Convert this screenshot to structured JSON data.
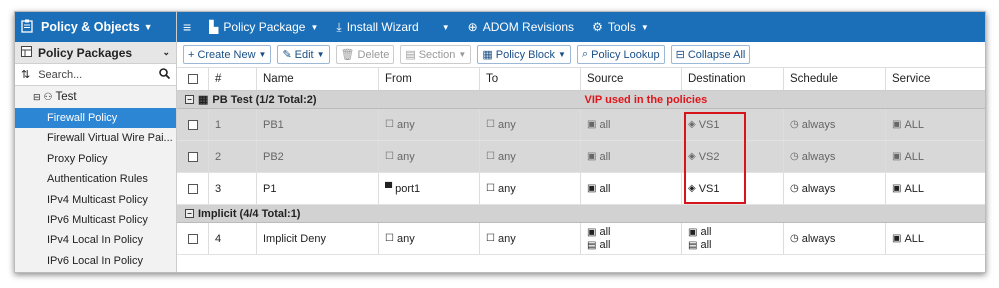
{
  "left_panel": {
    "header_title": "Policy & Objects",
    "section_title": "Policy Packages",
    "search_placeholder": "Search...",
    "tree_root": "Test",
    "nav_items": [
      {
        "label": "Firewall Policy",
        "active": true
      },
      {
        "label": "Firewall Virtual Wire Pai...",
        "active": false
      },
      {
        "label": "Proxy Policy",
        "active": false
      },
      {
        "label": "Authentication Rules",
        "active": false
      },
      {
        "label": "IPv4 Multicast Policy",
        "active": false
      },
      {
        "label": "IPv6 Multicast Policy",
        "active": false
      },
      {
        "label": "IPv4 Local In Policy",
        "active": false
      },
      {
        "label": "IPv6 Local In Policy",
        "active": false
      }
    ]
  },
  "topbar": {
    "menu_icon": "hamburger-icon",
    "policy_package": "Policy Package",
    "install_wizard": "Install Wizard",
    "adom_revisions": "ADOM Revisions",
    "tools": "Tools"
  },
  "toolbar": {
    "create_new": "Create New",
    "edit": "Edit",
    "delete": "Delete",
    "section": "Section",
    "policy_block": "Policy Block",
    "policy_lookup": "Policy Lookup",
    "collapse_all": "Collapse All"
  },
  "table": {
    "headers": [
      "#",
      "Name",
      "From",
      "To",
      "Source",
      "Destination",
      "Schedule",
      "Service"
    ],
    "section1": {
      "label": "PB Test (1/2 Total:2)",
      "note": "VIP used in the policies"
    },
    "section2": {
      "label": "Implicit (4/4 Total:1)"
    },
    "rows": [
      {
        "num": "1",
        "name": "PB1",
        "from": "any",
        "to": "any",
        "source": "all",
        "destination": "VS1",
        "schedule": "always",
        "service": "ALL"
      },
      {
        "num": "2",
        "name": "PB2",
        "from": "any",
        "to": "any",
        "source": "all",
        "destination": "VS2",
        "schedule": "always",
        "service": "ALL"
      },
      {
        "num": "3",
        "name": "P1",
        "from": "port1",
        "to": "any",
        "source": "all",
        "destination": "VS1",
        "schedule": "always",
        "service": "ALL"
      }
    ],
    "implicit_row": {
      "num": "4",
      "name": "Implicit Deny",
      "from": "any",
      "to": "any",
      "source1": "all",
      "source2": "all",
      "dest1": "all",
      "dest2": "all",
      "schedule": "always",
      "service": "ALL"
    }
  },
  "colors": {
    "header_blue": "#1a6fb8",
    "active_blue": "#2d86d4",
    "highlight_red": "#d4151b"
  }
}
